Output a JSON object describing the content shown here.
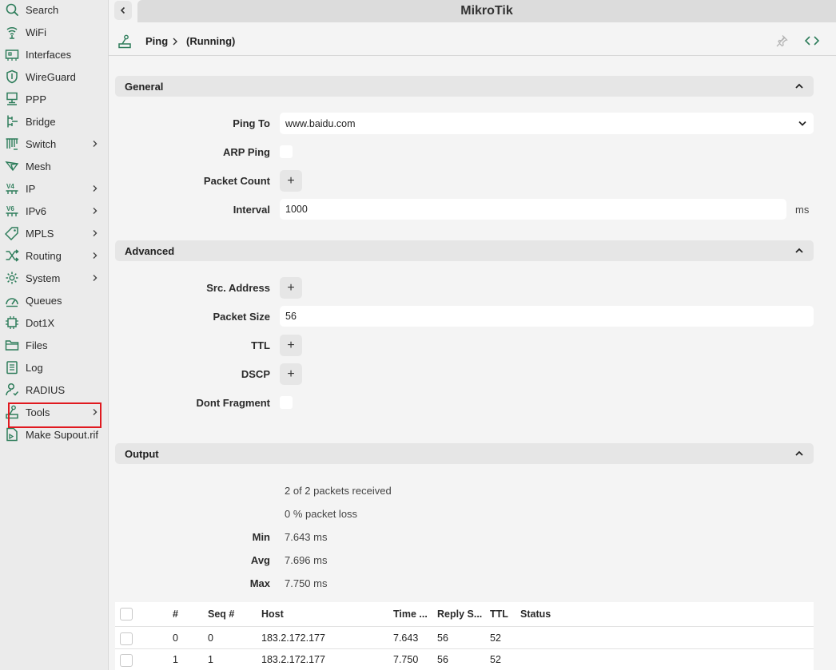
{
  "app": {
    "title": "MikroTik"
  },
  "sidebar": {
    "items": [
      {
        "label": "Search",
        "icon": "search-icon",
        "chevron": false
      },
      {
        "label": "WiFi",
        "icon": "wifi-icon",
        "chevron": false
      },
      {
        "label": "Interfaces",
        "icon": "interfaces-icon",
        "chevron": false
      },
      {
        "label": "WireGuard",
        "icon": "wireguard-icon",
        "chevron": false
      },
      {
        "label": "PPP",
        "icon": "ppp-icon",
        "chevron": false
      },
      {
        "label": "Bridge",
        "icon": "bridge-icon",
        "chevron": false
      },
      {
        "label": "Switch",
        "icon": "switch-icon",
        "chevron": true
      },
      {
        "label": "Mesh",
        "icon": "mesh-icon",
        "chevron": false
      },
      {
        "label": "IP",
        "icon": "ipv4-icon",
        "chevron": true
      },
      {
        "label": "IPv6",
        "icon": "ipv6-icon",
        "chevron": true
      },
      {
        "label": "MPLS",
        "icon": "mpls-icon",
        "chevron": true
      },
      {
        "label": "Routing",
        "icon": "routing-icon",
        "chevron": true
      },
      {
        "label": "System",
        "icon": "gear-icon",
        "chevron": true
      },
      {
        "label": "Queues",
        "icon": "queues-icon",
        "chevron": false
      },
      {
        "label": "Dot1X",
        "icon": "dot1x-icon",
        "chevron": false
      },
      {
        "label": "Files",
        "icon": "folder-icon",
        "chevron": false
      },
      {
        "label": "Log",
        "icon": "log-icon",
        "chevron": false
      },
      {
        "label": "RADIUS",
        "icon": "radius-icon",
        "chevron": false
      },
      {
        "label": "Tools",
        "icon": "tools-icon",
        "chevron": true
      },
      {
        "label": "Make Supout.rif",
        "icon": "supout-icon",
        "chevron": false
      }
    ]
  },
  "breadcrumb": {
    "page": "Ping",
    "status": "(Running)"
  },
  "sections": {
    "general": {
      "title": "General",
      "ping_to_label": "Ping To",
      "ping_to_value": "www.baidu.com",
      "arp_ping_label": "ARP Ping",
      "packet_count_label": "Packet Count",
      "interval_label": "Interval",
      "interval_value": "1000",
      "interval_unit": "ms"
    },
    "advanced": {
      "title": "Advanced",
      "src_address_label": "Src. Address",
      "packet_size_label": "Packet Size",
      "packet_size_value": "56",
      "ttl_label": "TTL",
      "dscp_label": "DSCP",
      "dont_fragment_label": "Dont Fragment"
    },
    "output": {
      "title": "Output",
      "received": "2 of 2 packets received",
      "loss": "0 % packet loss",
      "min_label": "Min",
      "min_value": "7.643 ms",
      "avg_label": "Avg",
      "avg_value": "7.696 ms",
      "max_label": "Max",
      "max_value": "7.750 ms"
    }
  },
  "table": {
    "headers": [
      "#",
      "Seq #",
      "Host",
      "Time ...",
      "Reply S...",
      "TTL",
      "Status"
    ],
    "rows": [
      [
        "0",
        "0",
        "183.2.172.177",
        "7.643",
        "56",
        "52",
        ""
      ],
      [
        "1",
        "1",
        "183.2.172.177",
        "7.750",
        "56",
        "52",
        ""
      ]
    ]
  },
  "plus_symbol": "+",
  "colors": {
    "icon": "#2e7d5b",
    "highlight": "#e0191f",
    "accent_gray": "#e6e6e6"
  }
}
